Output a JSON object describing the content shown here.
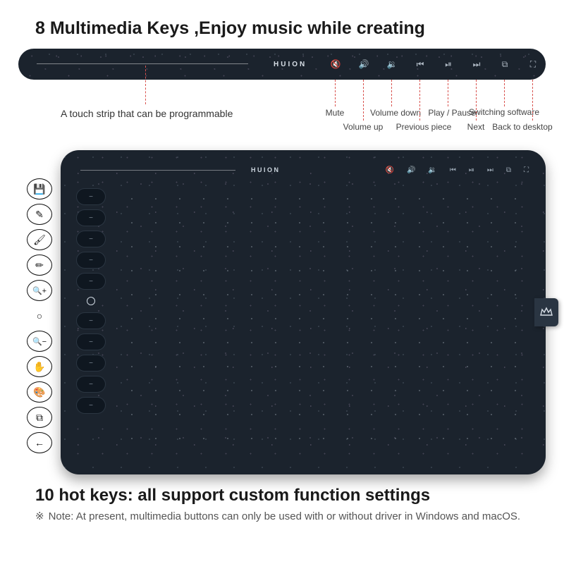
{
  "heading": "8 Multimedia Keys ,Enjoy music while creating",
  "brand": "HUION",
  "touch_strip_caption": "A touch strip that can be programmable",
  "multimedia_keys": [
    {
      "name": "mute",
      "label": "Mute",
      "glyph": "🔇"
    },
    {
      "name": "volume-up",
      "label": "Volume up",
      "glyph": "🔊"
    },
    {
      "name": "volume-down",
      "label": "Volume down",
      "glyph": "🔉"
    },
    {
      "name": "previous",
      "label": "Previous piece",
      "glyph": "⏮"
    },
    {
      "name": "play-pause",
      "label": "Play / Pause",
      "glyph": "⏯"
    },
    {
      "name": "next",
      "label": "Next",
      "glyph": "⏭"
    },
    {
      "name": "switch-software",
      "label": "Switching software",
      "glyph": "⧉"
    },
    {
      "name": "back-to-desktop",
      "label": "Back to desktop",
      "glyph": "⛶"
    }
  ],
  "hotkeys": [
    {
      "name": "save",
      "glyph": "💾"
    },
    {
      "name": "pen",
      "glyph": "✎"
    },
    {
      "name": "brush",
      "glyph": "🖌"
    },
    {
      "name": "pencil",
      "glyph": "✏"
    },
    {
      "name": "zoom-in",
      "glyph": "🔍+"
    },
    {
      "name": "ring",
      "glyph": "○"
    },
    {
      "name": "zoom-out",
      "glyph": "🔍−"
    },
    {
      "name": "hand",
      "glyph": "✋"
    },
    {
      "name": "palette",
      "glyph": "🎨"
    },
    {
      "name": "duplicate",
      "glyph": "⧉"
    },
    {
      "name": "back",
      "glyph": "←"
    }
  ],
  "subheading": "10 hot keys: all support custom function settings",
  "note_symbol": "※",
  "note": "Note: At present, multimedia buttons can only be used with or without driver in Windows and macOS."
}
